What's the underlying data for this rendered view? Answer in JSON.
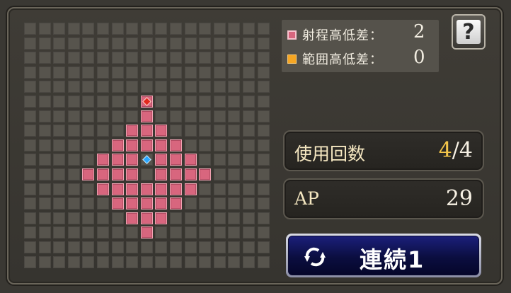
{
  "legend": {
    "range_height_label": "射程高低差：",
    "range_height_value": "2",
    "area_height_label": "範囲高低差：",
    "area_height_value": "0"
  },
  "help": {
    "glyph": "?"
  },
  "stats": {
    "uses_label": "使用回数",
    "uses_current": "4",
    "uses_sep": "/",
    "uses_max": "4",
    "ap_label": "AP",
    "ap_value": "29"
  },
  "combo": {
    "label": "連続1",
    "icon": "refresh-cycle-icon"
  },
  "colors": {
    "range_cell": "#d8667e",
    "area_marker": "#f6a623",
    "target_marker": "#e2291e",
    "caster_marker": "#2aa6ff"
  },
  "grid": {
    "columns": 17,
    "rows": 17,
    "range_rows": [
      [
        6,
        [
          8
        ]
      ],
      [
        7,
        [
          7,
          8,
          9
        ]
      ],
      [
        8,
        [
          6,
          7,
          8,
          9,
          10
        ]
      ],
      [
        9,
        [
          5,
          6,
          7,
          8,
          9,
          10,
          11
        ]
      ],
      [
        10,
        [
          4,
          5,
          6,
          7,
          9,
          10,
          11,
          12
        ]
      ],
      [
        11,
        [
          5,
          6,
          7,
          8,
          9,
          10,
          11
        ]
      ],
      [
        12,
        [
          6,
          7,
          8,
          9,
          10
        ]
      ],
      [
        13,
        [
          7,
          8,
          9
        ]
      ],
      [
        14,
        [
          8
        ]
      ]
    ],
    "target_cell": [
      5,
      8
    ],
    "caster_cell": [
      9,
      8
    ]
  }
}
